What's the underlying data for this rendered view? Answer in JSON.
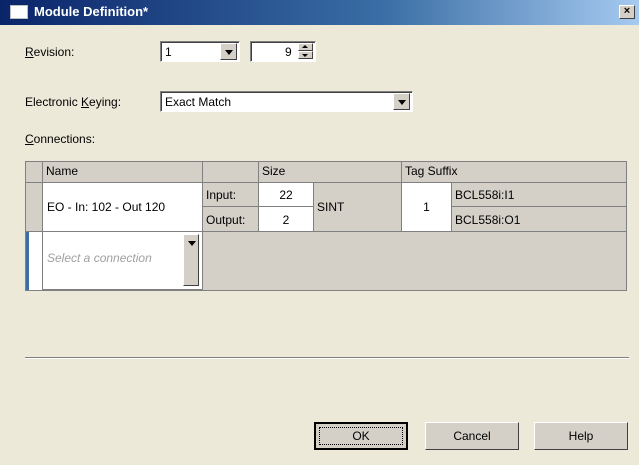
{
  "window": {
    "title": "Module Definition*",
    "close_glyph": "×"
  },
  "revision": {
    "label_prefix": "",
    "label_accel": "R",
    "label_rest": "evision:",
    "major": "1",
    "minor": "9"
  },
  "keying": {
    "label_prefix": "Electronic ",
    "label_accel": "K",
    "label_rest": "eying:",
    "value": "Exact Match"
  },
  "connections": {
    "label_accel": "C",
    "label_rest": "onnections:",
    "headers": {
      "name": "Name",
      "blank": "",
      "size": "Size",
      "tag_suffix": "Tag Suffix"
    },
    "row": {
      "name": "EO - In: 102 - Out 120",
      "input_label": "Input:",
      "output_label": "Output:",
      "input_size": "22",
      "output_size": "2",
      "data_type": "SINT",
      "instance": "1",
      "input_tag": "BCL558i:I1",
      "output_tag": "BCL558i:O1"
    },
    "new_row_placeholder": "Select a connection"
  },
  "buttons": {
    "ok": "OK",
    "cancel": "Cancel",
    "help": "Help"
  },
  "icons": [
    "window-icon",
    "close-icon",
    "dropdown-arrow-icon",
    "spin-up-icon",
    "spin-down-icon"
  ]
}
